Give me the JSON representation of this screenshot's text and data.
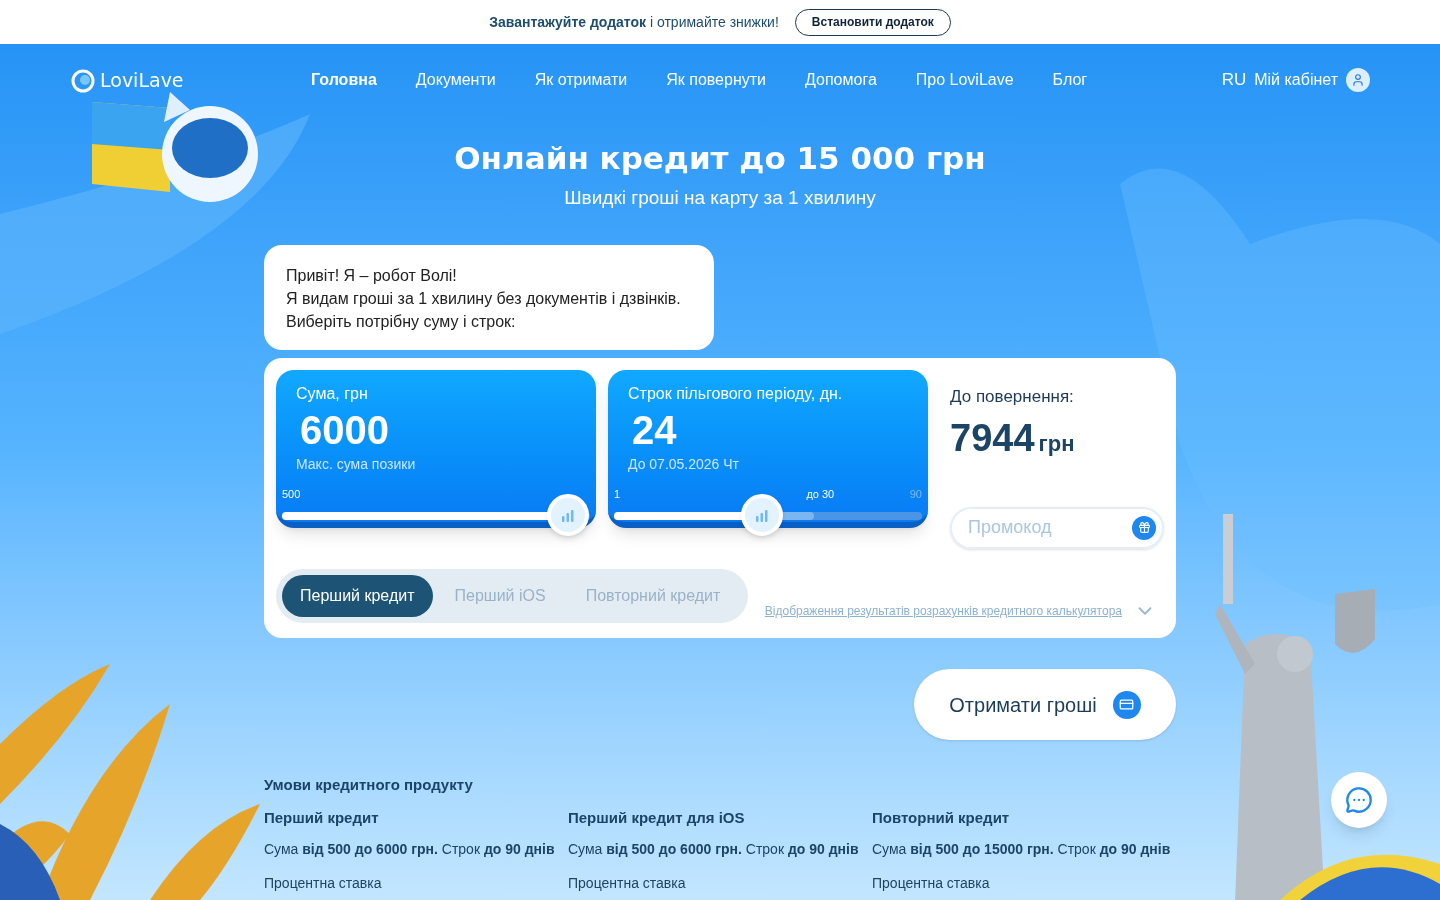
{
  "banner": {
    "text": "**Завантажуйте додаток** і отримайте знижки!",
    "button": "Встановити додаток"
  },
  "header": {
    "logo": "LoviLave",
    "nav": [
      {
        "label": "Головна",
        "selected": true
      },
      {
        "label": "Документи",
        "selected": false
      },
      {
        "label": "Як отримати",
        "selected": false
      },
      {
        "label": "Як повернути",
        "selected": false
      },
      {
        "label": "Допомога",
        "selected": false
      },
      {
        "label": "Про LoviLave",
        "selected": false
      },
      {
        "label": "Блог",
        "selected": false
      }
    ],
    "language": "RU",
    "cabinet": "Мій кабінет"
  },
  "hero": {
    "title": "Онлайн кредит до 15 000 грн",
    "subtitle": "Швидкі гроші на карту за 1 хвилину"
  },
  "bubble": {
    "lines": [
      "Привіт! Я – робот Волі!",
      "Я видам гроші за 1 хвилину без документів і дзвінків. Виберіть потрібну суму і строк:"
    ]
  },
  "calculator": {
    "sliders": [
      {
        "label": "Сума, грн",
        "value": "6000",
        "note": "Макс. сума позики",
        "level": 0.93,
        "ticks": [
          "500"
        ]
      },
      {
        "label": "Строк пільгового періоду, дн.",
        "value": "24",
        "note": "До 07.05.2026 Чт",
        "level": 0.48,
        "ticks": [
          "1",
          "до 30",
          "90"
        ]
      }
    ],
    "result": {
      "label": "До повернення:",
      "amount": "7944",
      "currency": "грн"
    },
    "promo": {
      "placeholder": "Промокод"
    },
    "tabs": [
      {
        "label": "Перший кредит",
        "selected": true
      },
      {
        "label": "Перший iOS",
        "selected": false
      },
      {
        "label": "Повторний кредит",
        "selected": false
      }
    ],
    "disclaimer": "Відображення результатів розрахунків кредитного калькулятора"
  },
  "cta": "Отримати гроші",
  "conditions": {
    "title": "Умови кредитного продукту",
    "columns": [
      {
        "title": "Перший кредит",
        "terms": "Сума **від 500 до 6000 грн.** Строк **до 90 днів**",
        "rate": "Процентна ставка"
      },
      {
        "title": "Перший кредит для iOS",
        "terms": "Сума **від 500 до 6000 грн.** Строк **до 90 днів**",
        "rate": "Процентна ставка"
      },
      {
        "title": "Повторний кредит",
        "terms": "Сума **від 500 до 15000 грн.** Строк **до 90 днів**",
        "rate": "Процентна ставка"
      }
    ]
  }
}
